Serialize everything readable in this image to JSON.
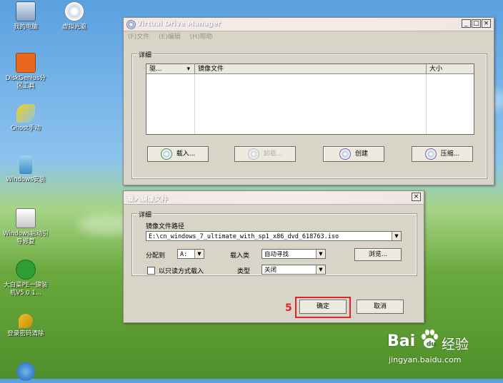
{
  "desktop": {
    "icons": [
      {
        "label": "我的电脑",
        "name": "my-computer-icon"
      },
      {
        "label": "DiskGenius分区工具",
        "name": "diskgenius-icon"
      },
      {
        "label": "Ghost手动",
        "name": "ghost-icon"
      },
      {
        "label": "Windows安装",
        "name": "windows-install-icon"
      },
      {
        "label": "Windows启动引导修复",
        "name": "boot-repair-icon"
      },
      {
        "label": "大白菜PE一键装机V5.0.1...",
        "name": "dabaicai-installer-icon"
      },
      {
        "label": "登录密码清除",
        "name": "password-clear-icon"
      }
    ],
    "top_icon2_label": "虚拟光驱"
  },
  "vdm": {
    "title": "Virtual Drive Manager",
    "menu": [
      "(F)文件",
      "(E)编辑",
      "(H)帮助"
    ],
    "group_label": "详细",
    "columns": [
      "驱...",
      "镜像文件",
      "大小"
    ],
    "buttons": {
      "load": "载入...",
      "unload": "卸载...",
      "create": "创建",
      "compress": "压缩..."
    }
  },
  "load_dialog": {
    "title": "载入镜像文件",
    "group_label": "详细",
    "path_label": "镜像文件路径",
    "path_value": "E:\\cn_windows_7_ultimate_with_sp1_x86_dvd_618763.iso",
    "drive_label": "分配到",
    "drive_value": "A:",
    "load_type_label": "载入类",
    "load_type_value": "自动寻找",
    "browse_label": "浏览...",
    "readonly_label": "以只读方式载入",
    "type_label": "类型",
    "type_value": "关闭",
    "ok_label": "确定",
    "cancel_label": "取消",
    "step_number": "5"
  },
  "watermark": {
    "brand": "Bai",
    "brand2": "经验",
    "url": "jingyan.baidu.com"
  },
  "colors": {
    "highlight": "#e2232a"
  }
}
